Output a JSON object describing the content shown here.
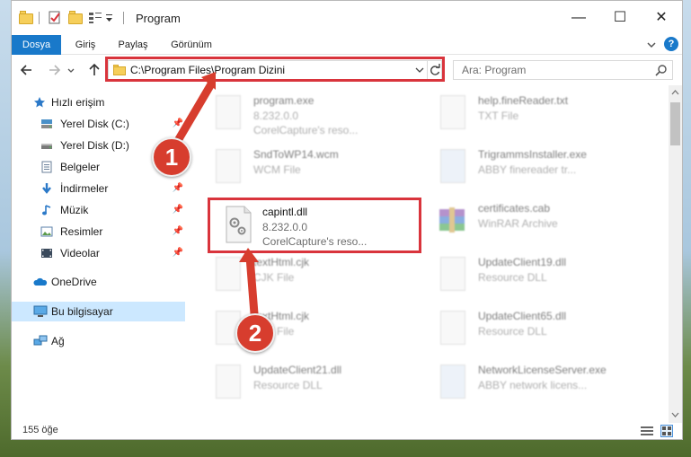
{
  "window": {
    "title": "Program",
    "controls": {
      "minimize": "—",
      "maximize": "☐",
      "close": "✕"
    }
  },
  "ribbon": {
    "tabs": [
      {
        "label": "Dosya",
        "active": true
      },
      {
        "label": "Giriş"
      },
      {
        "label": "Paylaş"
      },
      {
        "label": "Görünüm"
      }
    ],
    "expand_icon": "chevron-down-icon",
    "help_label": "?"
  },
  "address_bar": {
    "path": "C:\\Program Files\\Program Dizini",
    "refresh_icon": "refresh-icon"
  },
  "search": {
    "placeholder": "Ara: Program",
    "icon": "search-icon"
  },
  "sidebar": {
    "quick_access": "Hızlı erişim",
    "items": [
      {
        "label": "Yerel Disk (C:)",
        "icon": "drive-icon",
        "pinned": true
      },
      {
        "label": "Yerel Disk (D:)",
        "icon": "drive-icon",
        "pinned": false
      },
      {
        "label": "Belgeler",
        "icon": "documents-icon",
        "pinned": true
      },
      {
        "label": "İndirmeler",
        "icon": "download-icon",
        "pinned": true
      },
      {
        "label": "Müzik",
        "icon": "music-icon",
        "pinned": true
      },
      {
        "label": "Resimler",
        "icon": "pictures-icon",
        "pinned": true
      },
      {
        "label": "Videolar",
        "icon": "videos-icon",
        "pinned": true
      }
    ],
    "onedrive": "OneDrive",
    "this_pc": "Bu bilgisayar",
    "network": "Ağ"
  },
  "files": [
    {
      "name": "program.exe",
      "line2": "8.232.0.0",
      "line3": "CorelCapture's reso..."
    },
    {
      "name": "help.fineReader.txt",
      "line2": "TXT File",
      "line3": ""
    },
    {
      "name": "SndToWP14.wcm",
      "line2": "WCM File",
      "line3": ""
    },
    {
      "name": "TrigrammsInstaller.exe",
      "line2": "ABBY finereader tr...",
      "line3": ""
    },
    {
      "name": "capintl.dll",
      "line2": "8.232.0.0",
      "line3": "CorelCapture's reso..."
    },
    {
      "name": "certificates.cab",
      "line2": "WinRAR Archive",
      "line3": ""
    },
    {
      "name": "textHtml.cjk",
      "line2": "CJK File",
      "line3": ""
    },
    {
      "name": "UpdateClient19.dll",
      "line2": "Resource DLL",
      "line3": ""
    },
    {
      "name": "textHtml.cjk",
      "line2": "CJK File",
      "line3": ""
    },
    {
      "name": "UpdateClient65.dll",
      "line2": "Resource DLL",
      "line3": ""
    },
    {
      "name": "UpdateClient21.dll",
      "line2": "Resource DLL",
      "line3": ""
    },
    {
      "name": "NetworkLicenseServer.exe",
      "line2": "ABBY network licens...",
      "line3": ""
    }
  ],
  "annotations": {
    "step1": "1",
    "step2": "2",
    "highlight_color": "#d9343c"
  },
  "status": {
    "item_count": "155 öğe"
  },
  "colors": {
    "accent": "#1979ca",
    "selection": "#cce8ff",
    "folder": "#f6cf5b"
  }
}
